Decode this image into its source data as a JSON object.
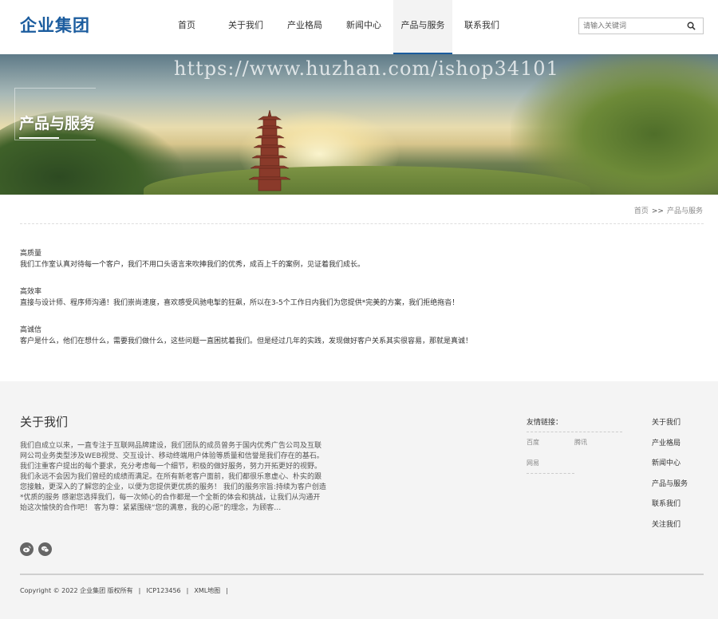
{
  "header": {
    "logo": "企业集团",
    "nav": [
      "首页",
      "关于我们",
      "产业格局",
      "新闻中心",
      "产品与服务",
      "联系我们"
    ],
    "active_nav_index": 4,
    "search_placeholder": "请输入关键词"
  },
  "banner": {
    "title": "产品与服务",
    "watermark": "https://www.huzhan.com/ishop34101"
  },
  "breadcrumb": {
    "home": "首页",
    "separator": ">>",
    "current": "产品与服务"
  },
  "features": [
    {
      "title": "高质量",
      "desc": "我们工作室认真对待每一个客户，我们不用口头语言来吹捧我们的优秀，成百上千的案例，见证着我们成长。"
    },
    {
      "title": "高效率",
      "desc": "直接与设计师、程序师沟通！我们崇尚速度，喜欢感受风驰电掣的狂飙，所以在3-5个工作日内我们为您提供*完美的方案，我们拒绝拖沓！"
    },
    {
      "title": "高诚信",
      "desc": "客户是什么，他们在想什么，需要我们做什么，这些问题一直困扰着我们。但是经过几年的实践，发现做好客户关系其实很容易，那就是真诚！"
    }
  ],
  "footer": {
    "about_title": "关于我们",
    "about_text": "我们自成立以来，一直专注于互联网品牌建设，我们团队的成员曾务于国内优秀广告公司及互联网公司业务类型涉及WEB视觉、交互设计、移动终端用户体验等质量和信誉是我们存在的基石。我们注重客户提出的每个要求，充分考虑每一个细节，积极的做好服务，努力开拓更好的视野。我们永远不会因为我们曾经的成绩而满足。在所有新老客户面前，我们都很乐意虚心、朴实的跟您接触，更深入的了解您的企业，以便为您提供更优质的服务！  我们的服务宗旨:持续为客户创造*优质的服务  感谢您选择我们，每一次倾心的合作都是一个全新的体会和挑战，让我们从沟通开始这次愉快的合作吧！  客为尊：紧紧围绕“您的满意，我的心愿”的理念，为顾客…",
    "friend_title": "友情链接：",
    "friend_links": [
      "百度",
      "腾讯",
      "网易"
    ],
    "quick_links": [
      "关于我们",
      "产业格局",
      "新闻中心",
      "产品与服务",
      "联系我们",
      "关注我们"
    ],
    "copyright": "Copyright © 2022 企业集团 版权所有",
    "icp": "ICP123456",
    "sitemap": "XML地图",
    "bar": "|"
  }
}
